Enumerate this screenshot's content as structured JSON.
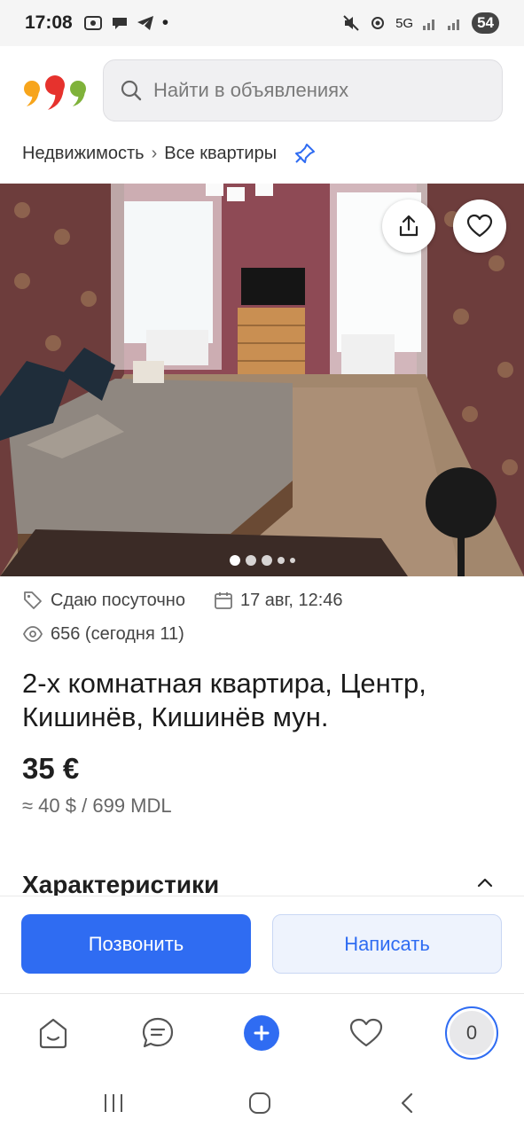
{
  "status_bar": {
    "time": "17:08",
    "network": "5G",
    "battery": "54"
  },
  "header": {
    "logo_icon": "999-logo",
    "search_placeholder": "Найти в объявлениях"
  },
  "breadcrumb": {
    "items": [
      "Недвижимость",
      "Все квартиры"
    ],
    "separator": "›"
  },
  "gallery": {
    "photo_description": "bedroom",
    "photo_count_indicator": 5,
    "active_index": 0
  },
  "meta": {
    "category": "Сдаю посуточно",
    "date": "17 авг, 12:46",
    "views": "656 (сегодня 11)"
  },
  "listing": {
    "title": "2-х комнатная квартира, Центр, Кишинёв, Кишинёв мун.",
    "price": "35 €",
    "price_alt": "≈ 40 $ / 699 MDL"
  },
  "section": {
    "title": "Характеристики"
  },
  "actions": {
    "call_label": "Позвонить",
    "message_label": "Написать"
  },
  "bottom_nav": {
    "profile_badge": "0"
  },
  "colors": {
    "accent": "#2f6cf2",
    "logo_orange": "#f7a51c",
    "logo_red": "#e6322d",
    "logo_green": "#7fb23a"
  }
}
